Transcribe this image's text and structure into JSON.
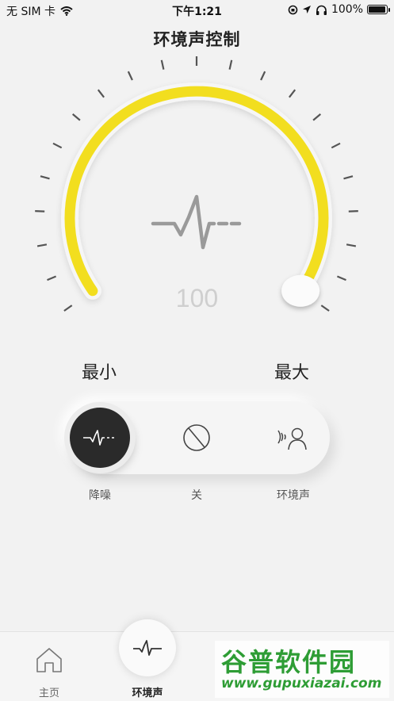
{
  "status_bar": {
    "carrier": "无 SIM 卡",
    "time": "下午1:21",
    "battery_percent": "100%",
    "battery_level": 1.0,
    "icons": [
      "wifi-icon",
      "rotation-lock-icon",
      "location-arrow-icon",
      "headphones-icon",
      "battery-icon"
    ]
  },
  "page": {
    "title": "环境声控制"
  },
  "dial": {
    "value": "100",
    "level": 1.0,
    "min_label": "最小",
    "max_label": "最大",
    "center_icon": "waveform-icon",
    "colors": {
      "arc": "#f2de1f",
      "ticks": "#555555",
      "track": "#f6f6f6"
    }
  },
  "modes": {
    "active": "noise-cancelling",
    "items": [
      {
        "id": "noise-cancelling",
        "label": "降噪",
        "icon": "waveform-icon"
      },
      {
        "id": "off",
        "label": "关",
        "icon": "off-icon"
      },
      {
        "id": "ambient",
        "label": "环境声",
        "icon": "ambient-sound-icon"
      }
    ]
  },
  "tab_bar": {
    "items": [
      {
        "label": "主页",
        "icon": "home-icon"
      },
      {
        "label": "环境声",
        "icon": "waveform-icon",
        "active": true
      }
    ]
  },
  "watermark": {
    "title": "谷普软件园",
    "url": "www.gupuxiazai.com",
    "color": "#2e9d35"
  }
}
